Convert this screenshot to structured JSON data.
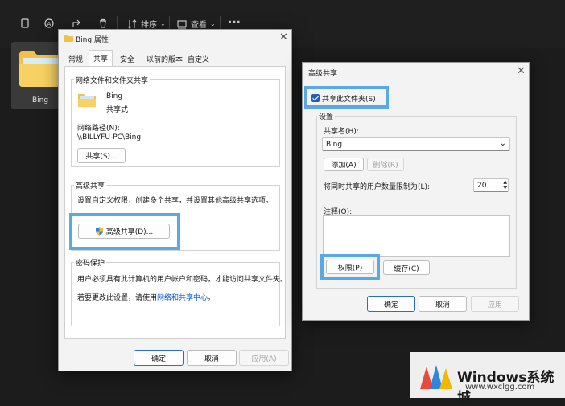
{
  "explorer": {
    "sort_label": "排序",
    "view_label": "查看",
    "more_label": "···",
    "folder_name": "Bing"
  },
  "props": {
    "title": "Bing 属性",
    "tabs": [
      "常规",
      "共享",
      "安全",
      "以前的版本",
      "自定义"
    ],
    "net_group_title": "网络文件和文件夹共享",
    "folder_name": "Bing",
    "share_state": "共享式",
    "net_path_label": "网络路径(N):",
    "net_path": "\\\\BILLYFU-PC\\Bing",
    "share_button": "共享(S)...",
    "adv_group_title": "高级共享",
    "adv_desc": "设置自定义权限，创建多个共享，并设置其他高级共享选项。",
    "adv_button": "高级共享(D)...",
    "pwd_group_title": "密码保护",
    "pwd_desc": "用户必须具有此计算机的用户帐户和密码，才能访问共享文件夹。",
    "pwd_change_prefix": "若要更改此设置，请使用",
    "pwd_link": "网络和共享中心",
    "pwd_change_suffix": "。",
    "ok": "确定",
    "cancel": "取消",
    "apply": "应用(A)"
  },
  "adv": {
    "title": "高级共享",
    "share_check_label": "共享此文件夹(S)",
    "settings_label": "设置",
    "share_name_label": "共享名(H):",
    "share_name_value": "Bing",
    "add_button": "添加(A)",
    "remove_button": "删除(R)",
    "limit_label": "将同时共享的用户数量限制为(L):",
    "limit_value": "20",
    "comment_label": "注释(O):",
    "permissions_button": "权限(P)",
    "cache_button": "缓存(C)",
    "ok": "确定",
    "cancel": "取消",
    "apply": "应用"
  },
  "watermark": {
    "title": "Windows系统城",
    "url": "www.wxclgg.com"
  },
  "colors": {
    "highlight": "#5aa9e6",
    "checkbox": "#1f5fbf",
    "link": "#0b5bd3"
  }
}
